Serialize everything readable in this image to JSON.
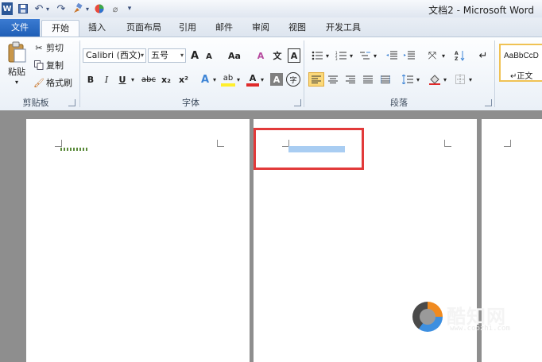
{
  "window": {
    "title": "文档2 - Microsoft Word",
    "quick_access": {
      "app_icon": "W",
      "save": "save-icon",
      "undo": "↶",
      "redo": "↷",
      "customize": "▾"
    }
  },
  "tabs": [
    {
      "label": "文件"
    },
    {
      "label": "开始"
    },
    {
      "label": "插入"
    },
    {
      "label": "页面布局"
    },
    {
      "label": "引用"
    },
    {
      "label": "邮件"
    },
    {
      "label": "审阅"
    },
    {
      "label": "视图"
    },
    {
      "label": "开发工具"
    }
  ],
  "ribbon": {
    "clipboard": {
      "label": "剪贴板",
      "paste": "粘贴",
      "cut": "剪切",
      "copy": "复制",
      "format_painter": "格式刷"
    },
    "font": {
      "label": "字体",
      "font_name": "Calibri (西文)",
      "font_size": "五号",
      "grow": "A",
      "shrink": "A",
      "change_case": "Aa",
      "clear": "A",
      "pinyin": "文",
      "border": "A",
      "bold": "B",
      "italic": "I",
      "underline": "U",
      "strike": "abc",
      "sub": "x₂",
      "sup": "x²",
      "effects": "A",
      "highlight": "ab",
      "color": "A",
      "shading": "A",
      "enclose": "字"
    },
    "paragraph": {
      "label": "段落"
    },
    "styles": {
      "sample": "AaBbCcD",
      "normal": "正文"
    }
  },
  "watermark": {
    "name": "酷知网",
    "url": "www.coozhi.com"
  },
  "colors": {
    "file_tab": "#2a6cc4",
    "highlight_box": "#e23a3a",
    "selection": "#a9cdf2",
    "style_border": "#f0c254"
  }
}
